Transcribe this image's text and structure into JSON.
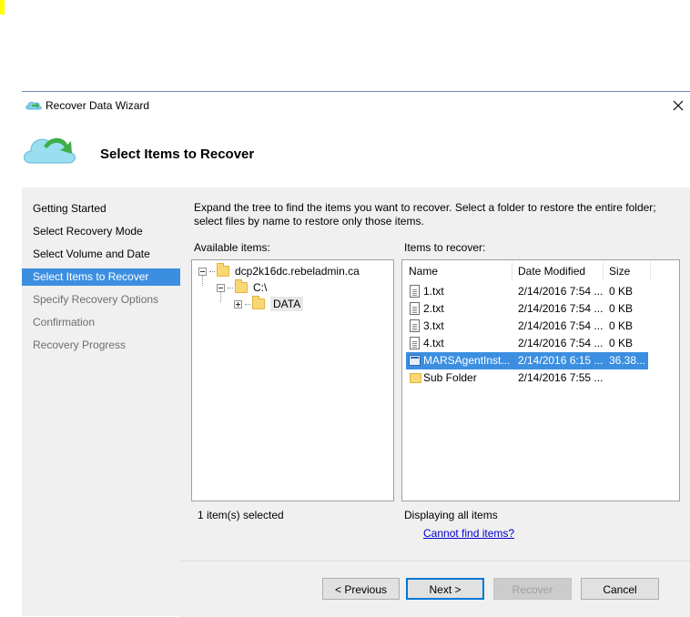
{
  "window": {
    "title": "Recover Data Wizard",
    "header_title": "Select Items to Recover"
  },
  "sidebar": {
    "items": [
      {
        "label": "Getting Started",
        "state": "normal"
      },
      {
        "label": "Select Recovery Mode",
        "state": "normal"
      },
      {
        "label": "Select Volume and Date",
        "state": "normal"
      },
      {
        "label": "Select Items to Recover",
        "state": "active"
      },
      {
        "label": "Specify Recovery Options",
        "state": "disabled"
      },
      {
        "label": "Confirmation",
        "state": "disabled"
      },
      {
        "label": "Recovery Progress",
        "state": "disabled"
      }
    ]
  },
  "content": {
    "instructions": "Expand the tree to find the items you want to recover. Select a folder to restore the entire folder; select files by name to restore only those items.",
    "available_label": "Available items:",
    "recover_label": "Items to recover:",
    "tree": {
      "root": "dcp2k16dc.rebeladmin.ca",
      "drive": "C:\\",
      "folder": "DATA"
    },
    "list": {
      "columns": {
        "name": "Name",
        "date": "Date Modified",
        "size": "Size"
      },
      "rows": [
        {
          "name": "1.txt",
          "date": "2/14/2016 7:54 ...",
          "size": "0 KB",
          "type": "file"
        },
        {
          "name": "2.txt",
          "date": "2/14/2016 7:54 ...",
          "size": "0 KB",
          "type": "file"
        },
        {
          "name": "3.txt",
          "date": "2/14/2016 7:54 ...",
          "size": "0 KB",
          "type": "file"
        },
        {
          "name": "4.txt",
          "date": "2/14/2016 7:54 ...",
          "size": "0 KB",
          "type": "file"
        },
        {
          "name": "MARSAgentInst...",
          "date": "2/14/2016 6:15 ...",
          "size": "36.38...",
          "type": "exe",
          "selected": true
        },
        {
          "name": "Sub Folder",
          "date": "2/14/2016 7:55 ...",
          "size": "",
          "type": "folder"
        }
      ]
    },
    "selected_count": "1 item(s) selected",
    "display_status": "Displaying all items",
    "cannot_find_link": "Cannot find items?"
  },
  "buttons": {
    "previous": "< Previous",
    "next": "Next >",
    "recover": "Recover",
    "cancel": "Cancel"
  },
  "colors": {
    "accent": "#3c8fe0",
    "link": "#0000cc"
  }
}
